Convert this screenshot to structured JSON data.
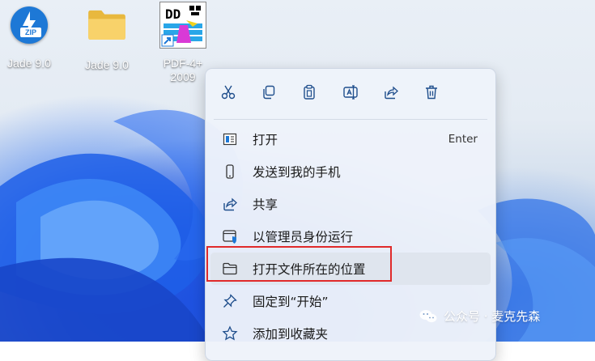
{
  "desktop": {
    "icons": [
      {
        "label": "Jade 9.0",
        "icon": "zip-archive-icon",
        "badge": "ZIP"
      },
      {
        "label": "Jade 9.0",
        "icon": "folder-icon"
      },
      {
        "label_line1": "PDF-4+",
        "label_line2": "2009",
        "icon": "pdf-app-shortcut-icon"
      }
    ]
  },
  "context_menu": {
    "toolbar": [
      {
        "name": "cut",
        "icon": "scissors-icon"
      },
      {
        "name": "copy",
        "icon": "copy-icon"
      },
      {
        "name": "paste",
        "icon": "clipboard-icon"
      },
      {
        "name": "rename",
        "icon": "rename-icon"
      },
      {
        "name": "share",
        "icon": "share-icon"
      },
      {
        "name": "delete",
        "icon": "trash-icon"
      }
    ],
    "items": [
      {
        "label": "打开",
        "shortcut": "Enter",
        "icon": "open-icon"
      },
      {
        "label": "发送到我的手机",
        "icon": "phone-icon"
      },
      {
        "label": "共享",
        "icon": "share-icon"
      },
      {
        "label": "以管理员身份运行",
        "icon": "admin-shield-icon"
      },
      {
        "label": "打开文件所在的位置",
        "icon": "folder-open-icon"
      },
      {
        "label": "固定到“开始”",
        "icon": "pin-icon"
      },
      {
        "label": "添加到收藏夹",
        "icon": "star-icon"
      }
    ]
  },
  "watermark": {
    "text": "公众号 · 麦克先森",
    "icon": "wechat-icon"
  },
  "colors": {
    "accent": "#1d78d6",
    "highlight_border": "#e02a2a",
    "menu_bg": "#eef3fa"
  }
}
